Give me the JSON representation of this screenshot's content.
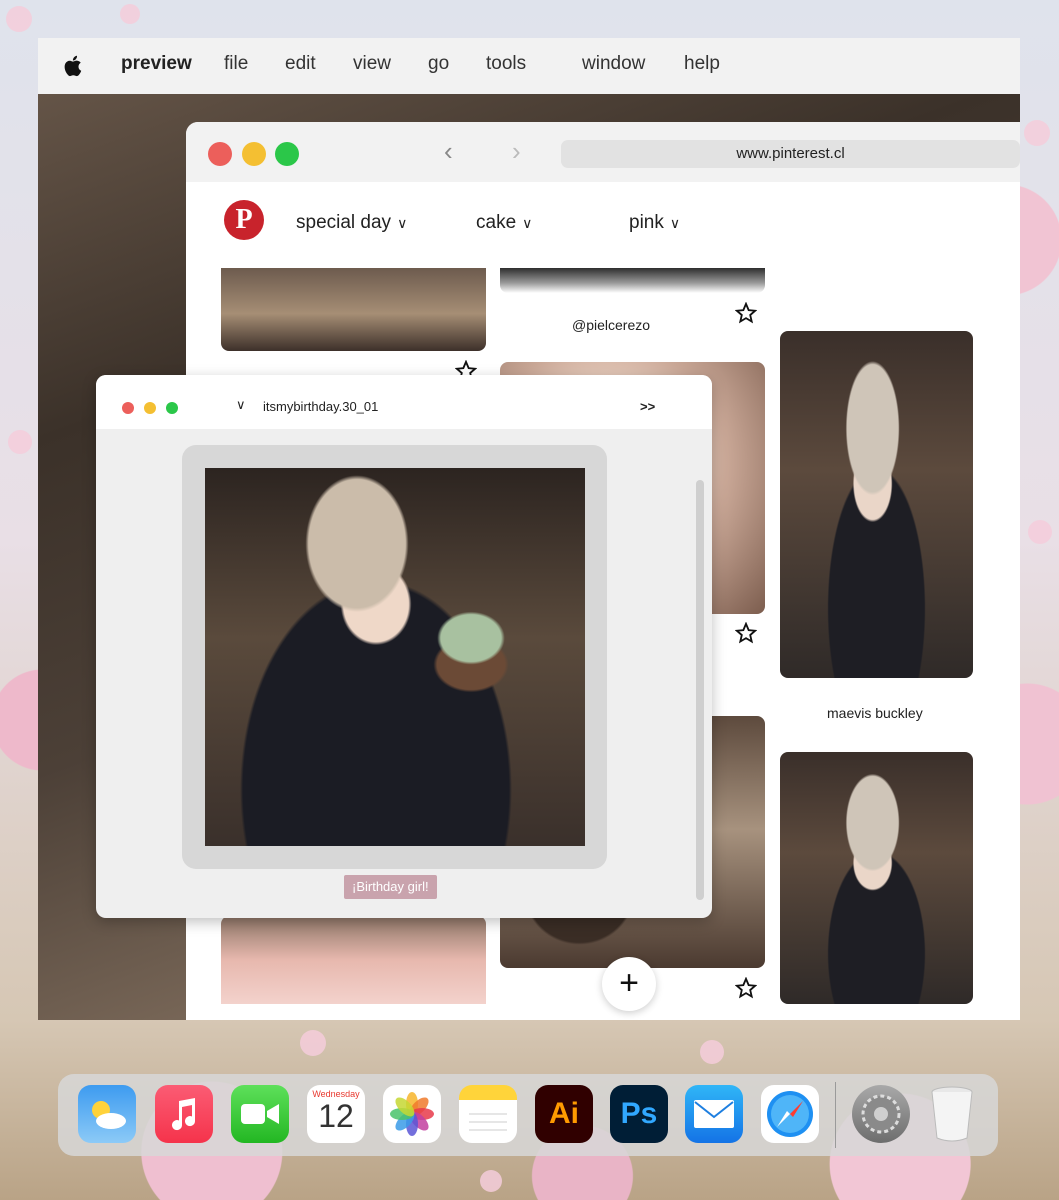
{
  "menubar": {
    "app_name": "preview",
    "items": [
      "file",
      "edit",
      "view",
      "go",
      "tools",
      "window",
      "help"
    ]
  },
  "browser": {
    "url": "www.pinterest.cl",
    "boards": [
      "special day",
      "cake",
      "pink"
    ],
    "pins": {
      "caption_1": "@pielcerezo",
      "caption_2": "maevis buckley"
    }
  },
  "viewer": {
    "title": "itsmybirthday.30_01",
    "next_label": ">>",
    "caption": "¡Birthday girl!"
  },
  "dock": {
    "calendar_day": "Wednesday",
    "calendar_date": "12",
    "illustrator_label": "Ai",
    "photoshop_label": "Ps",
    "apps": [
      "weather-icon",
      "music-icon",
      "facetime-icon",
      "calendar-icon",
      "photos-icon",
      "notes-icon",
      "illustrator-icon",
      "photoshop-icon",
      "mail-icon",
      "safari-icon",
      "system-settings-icon",
      "trash-icon"
    ]
  },
  "colors": {
    "pinterest_red": "#c8232c",
    "traffic_red": "#ec5f5b",
    "traffic_yellow": "#f4bf32",
    "traffic_green": "#2bc749",
    "caption_bg": "#c9a3ad"
  }
}
